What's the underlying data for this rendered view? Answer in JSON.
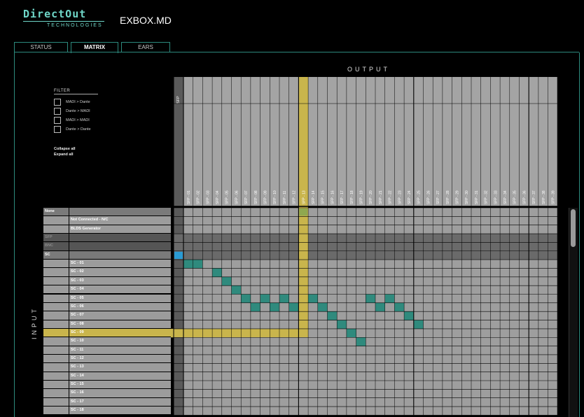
{
  "app": {
    "logo_main": "DirectOut",
    "logo_sub": "TECHNOLOGIES",
    "title": "EXBOX.MD"
  },
  "tabs": [
    {
      "label": "STATUS",
      "active": false
    },
    {
      "label": "MATRIX",
      "active": true
    },
    {
      "label": "EARS",
      "active": false
    }
  ],
  "matrix": {
    "output_title": "OUTPUT",
    "input_title": "INPUT",
    "sfp_header": "SFP",
    "columns": [
      "SFP - 01",
      "SFP - 02",
      "SFP - 03",
      "SFP - 04",
      "SFP - 05",
      "SFP - 06",
      "SFP - 07",
      "SFP - 08",
      "SFP - 09",
      "SFP - 10",
      "SFP - 11",
      "SFP - 12",
      "SFP - 13",
      "SFP - 14",
      "SFP - 15",
      "SFP - 16",
      "SFP - 17",
      "SFP - 18",
      "SFP - 19",
      "SFP - 20",
      "SFP - 21",
      "SFP - 22",
      "SFP - 23",
      "SFP - 24",
      "SFP - 25",
      "SFP - 26",
      "SFP - 27",
      "SFP - 28",
      "SFP - 29",
      "SFP - 30",
      "SFP - 31",
      "SFP - 32",
      "SFP - 33",
      "SFP - 34",
      "SFP - 35",
      "SFP - 36",
      "SFP - 37",
      "SFP - 38",
      "SFP - 39"
    ],
    "highlight_column": "SFP - 13",
    "highlight_row": "SC - 09",
    "rows": [
      {
        "group": "None",
        "name": "",
        "kind": "group"
      },
      {
        "group": "",
        "name": "Not Connected - N/C",
        "kind": "item"
      },
      {
        "group": "",
        "name": "BLDS Generator",
        "kind": "item"
      },
      {
        "group": "SFP",
        "name": "",
        "kind": "dim"
      },
      {
        "group": "BNC",
        "name": "",
        "kind": "dim"
      },
      {
        "group": "SC",
        "name": "",
        "kind": "group"
      },
      {
        "group": "",
        "name": "SC - 01",
        "kind": "item"
      },
      {
        "group": "",
        "name": "SC - 02",
        "kind": "item"
      },
      {
        "group": "",
        "name": "SC - 03",
        "kind": "item"
      },
      {
        "group": "",
        "name": "SC - 04",
        "kind": "item"
      },
      {
        "group": "",
        "name": "SC - 05",
        "kind": "item"
      },
      {
        "group": "",
        "name": "SC - 06",
        "kind": "item"
      },
      {
        "group": "",
        "name": "SC - 07",
        "kind": "item"
      },
      {
        "group": "",
        "name": "SC - 08",
        "kind": "item"
      },
      {
        "group": "",
        "name": "SC - 09",
        "kind": "item"
      },
      {
        "group": "",
        "name": "SC - 10",
        "kind": "item"
      },
      {
        "group": "",
        "name": "SC - 11",
        "kind": "item"
      },
      {
        "group": "",
        "name": "SC - 12",
        "kind": "item"
      },
      {
        "group": "",
        "name": "SC - 13",
        "kind": "item"
      },
      {
        "group": "",
        "name": "SC - 14",
        "kind": "item"
      },
      {
        "group": "",
        "name": "SC - 15",
        "kind": "item"
      },
      {
        "group": "",
        "name": "SC - 16",
        "kind": "item"
      },
      {
        "group": "",
        "name": "SC - 17",
        "kind": "item"
      },
      {
        "group": "",
        "name": "SC - 18",
        "kind": "item"
      }
    ],
    "connections": [
      {
        "row": "SC - 01",
        "col": "SFP - 01"
      },
      {
        "row": "SC - 01",
        "col": "SFP - 02"
      },
      {
        "row": "SC - 02",
        "col": "SFP - 04"
      },
      {
        "row": "SC - 03",
        "col": "SFP - 05"
      },
      {
        "row": "SC - 04",
        "col": "SFP - 06"
      },
      {
        "row": "SC - 05",
        "col": "SFP - 07"
      },
      {
        "row": "SC - 05",
        "col": "SFP - 09"
      },
      {
        "row": "SC - 05",
        "col": "SFP - 11"
      },
      {
        "row": "SC - 05",
        "col": "SFP - 14"
      },
      {
        "row": "SC - 05",
        "col": "SFP - 20"
      },
      {
        "row": "SC - 05",
        "col": "SFP - 22"
      },
      {
        "row": "SC - 06",
        "col": "SFP - 08"
      },
      {
        "row": "SC - 06",
        "col": "SFP - 10"
      },
      {
        "row": "SC - 06",
        "col": "SFP - 12"
      },
      {
        "row": "SC - 06",
        "col": "SFP - 15"
      },
      {
        "row": "SC - 06",
        "col": "SFP - 21"
      },
      {
        "row": "SC - 06",
        "col": "SFP - 23"
      },
      {
        "row": "SC - 07",
        "col": "SFP - 16"
      },
      {
        "row": "SC - 07",
        "col": "SFP - 24"
      },
      {
        "row": "SC - 08",
        "col": "SFP - 17"
      },
      {
        "row": "SC - 08",
        "col": "SFP - 25"
      },
      {
        "row": "SC - 09",
        "col": "SFP - 18"
      },
      {
        "row": "SC - 10",
        "col": "SFP - 19"
      }
    ],
    "sc_group_marker": {
      "row": "SC",
      "col": "SFP"
    },
    "none_marker": {
      "row": "None",
      "col": "SFP - 13"
    },
    "colors": {
      "connection": "#2f8a7d",
      "highlight": "#c9b54c",
      "none_marker": "#8fa84f",
      "sc_marker": "#2a9bd4",
      "grid_bg": "#9e9e9e",
      "header_bg": "#a4a4a4"
    }
  },
  "filter": {
    "title": "FILTER",
    "items": [
      "MADI > Dante",
      "Dante > MADI",
      "MADI > MADI",
      "Dante > Dante"
    ]
  },
  "links": {
    "collapse_all": "Collapse all",
    "expand_all": "Expand all"
  }
}
